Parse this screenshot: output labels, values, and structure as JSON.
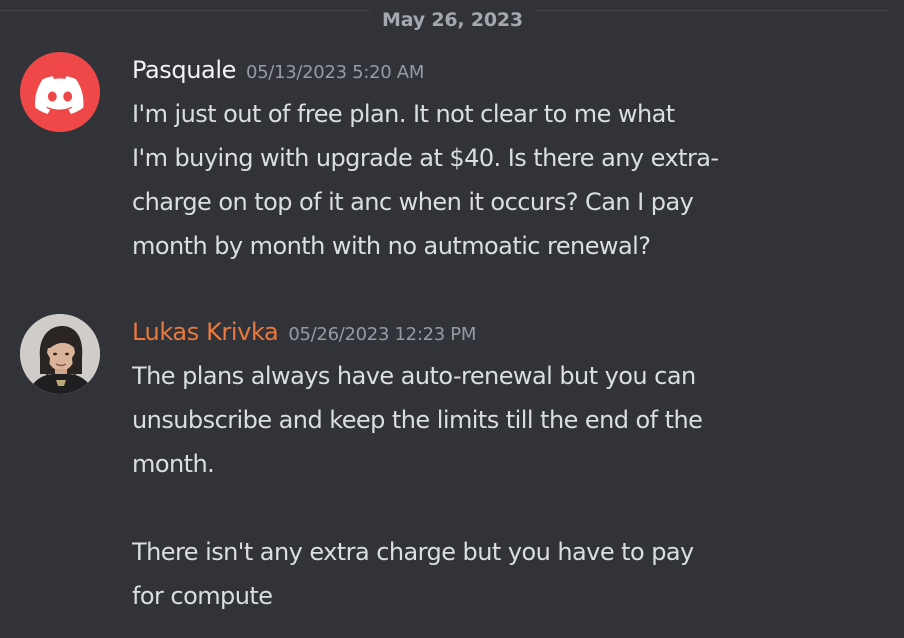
{
  "date_divider": "May 26, 2023",
  "messages": [
    {
      "author": "Pasquale",
      "author_color": "#f2f3f5",
      "avatar": "discord-logo-icon",
      "avatar_color": "#f04848",
      "timestamp": "05/13/2023 5:20 AM",
      "lines": [
        "I'm just out of free plan. It not clear to me what",
        "I'm buying with upgrade at $40. Is there any extra-",
        "charge on top of it anc when it occurs? Can I pay",
        "month by month with no autmoatic renewal?"
      ]
    },
    {
      "author": "Lukas Krivka",
      "author_color": "#e8793f",
      "avatar": "user-photo-avatar",
      "timestamp": "05/26/2023 12:23 PM",
      "paragraphs": [
        [
          "The plans always have auto-renewal but you can",
          "unsubscribe and keep the limits till the end of the",
          "month."
        ],
        [
          "There isn't any extra charge but you have to pay",
          "for compute"
        ]
      ]
    }
  ]
}
